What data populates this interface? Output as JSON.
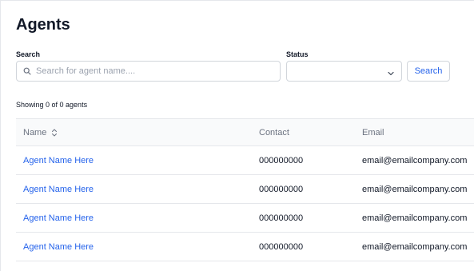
{
  "page": {
    "title": "Agents"
  },
  "filters": {
    "search_label": "Search",
    "search_placeholder": "Search for agent name....",
    "search_value": "",
    "status_label": "Status",
    "status_value": "",
    "search_button_label": "Search"
  },
  "summary": {
    "showing_text": "Showing 0 of 0 agents"
  },
  "table": {
    "columns": {
      "name": "Name",
      "contact": "Contact",
      "email": "Email"
    },
    "rows": [
      {
        "name": "Agent Name Here",
        "contact": "000000000",
        "email": "email@emailcompany.com"
      },
      {
        "name": "Agent Name Here",
        "contact": "000000000",
        "email": "email@emailcompany.com"
      },
      {
        "name": "Agent Name Here",
        "contact": "000000000",
        "email": "email@emailcompany.com"
      },
      {
        "name": "Agent Name Here",
        "contact": "000000000",
        "email": "email@emailcompany.com"
      }
    ]
  },
  "icons": {
    "search_input": "search-icon",
    "status_dropdown": "chevron-down-icon",
    "name_sort": "sort-icon"
  },
  "colors": {
    "link": "#2563eb",
    "header_bg": "#f9fafb",
    "border": "#e5e7eb"
  }
}
